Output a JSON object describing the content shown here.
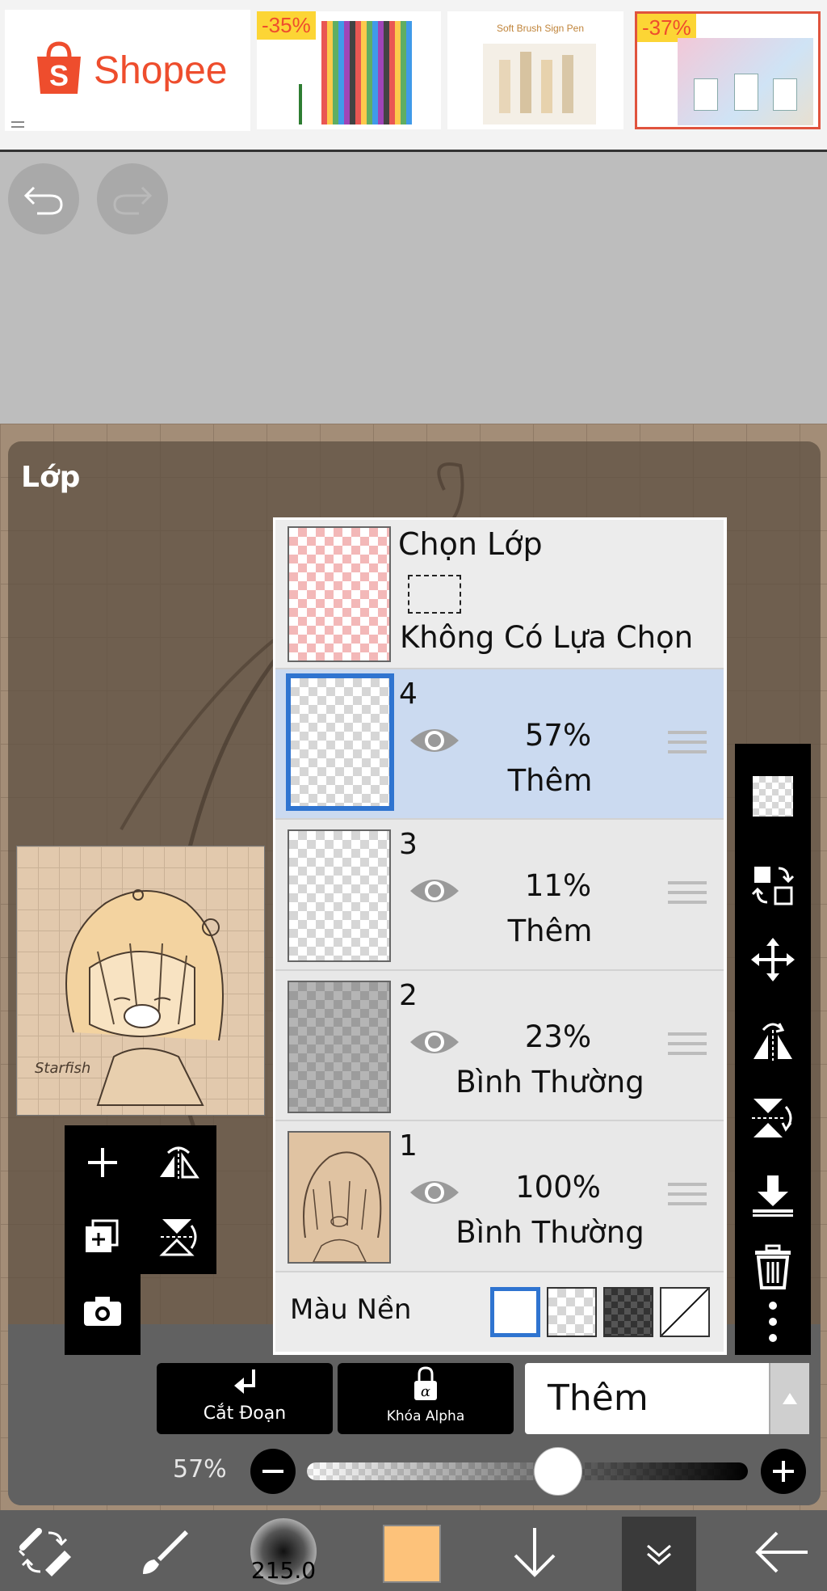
{
  "ad": {
    "brand": "Shopee",
    "discount_1": "-35%",
    "discount_2": "-37%",
    "product_2_title": "Soft Brush Sign Pen"
  },
  "panel": {
    "title": "Lớp"
  },
  "selection": {
    "title": "Chọn Lớp",
    "status": "Không Có Lựa Chọn"
  },
  "layers": [
    {
      "number": "4",
      "opacity": "57%",
      "mode": "Thêm",
      "selected": true
    },
    {
      "number": "3",
      "opacity": "11%",
      "mode": "Thêm",
      "selected": false
    },
    {
      "number": "2",
      "opacity": "23%",
      "mode": "Bình Thường",
      "selected": false
    },
    {
      "number": "1",
      "opacity": "100%",
      "mode": "Bình Thường",
      "selected": false
    }
  ],
  "background": {
    "label": "Màu Nền"
  },
  "actions": {
    "clipping_label": "Cắt Đoạn",
    "alpha_lock_label": "Khóa Alpha",
    "blend_mode_value": "Thêm"
  },
  "opacity_slider": {
    "label": "57%",
    "value": 0.57
  },
  "toolbar": {
    "brush_size": "215.0",
    "current_color": "#fdc27a"
  },
  "icons": {
    "undo": "undo-icon",
    "redo": "redo-icon",
    "visibility": "eye-icon",
    "add_layer": "plus-icon",
    "camera": "camera-icon"
  }
}
